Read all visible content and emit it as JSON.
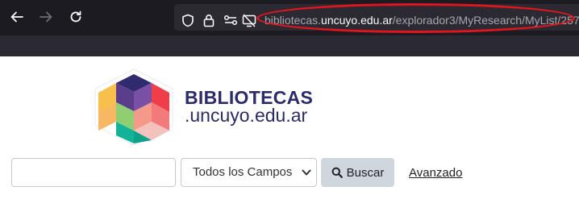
{
  "browser": {
    "url": {
      "domain_prefix": "bibliotecas.",
      "domain_main": "uncuyo.edu.ar",
      "path": "/explorador3/MyResearch/MyList/257"
    },
    "icons": [
      "back-arrow-icon",
      "forward-arrow-icon",
      "reload-icon",
      "shield-icon",
      "lock-icon",
      "permissions-icon",
      "screen-share-blocked-icon"
    ],
    "annotation_color": "#e0151d"
  },
  "site": {
    "brand_title": "BIBLIOTECAS",
    "brand_subtitle": ".uncuyo.edu.ar",
    "brand_color": "#2b2a6b"
  },
  "search": {
    "query_value": "",
    "type_selected": "Todos los Campos",
    "search_label": "Buscar",
    "advanced_label": "Avanzado"
  }
}
